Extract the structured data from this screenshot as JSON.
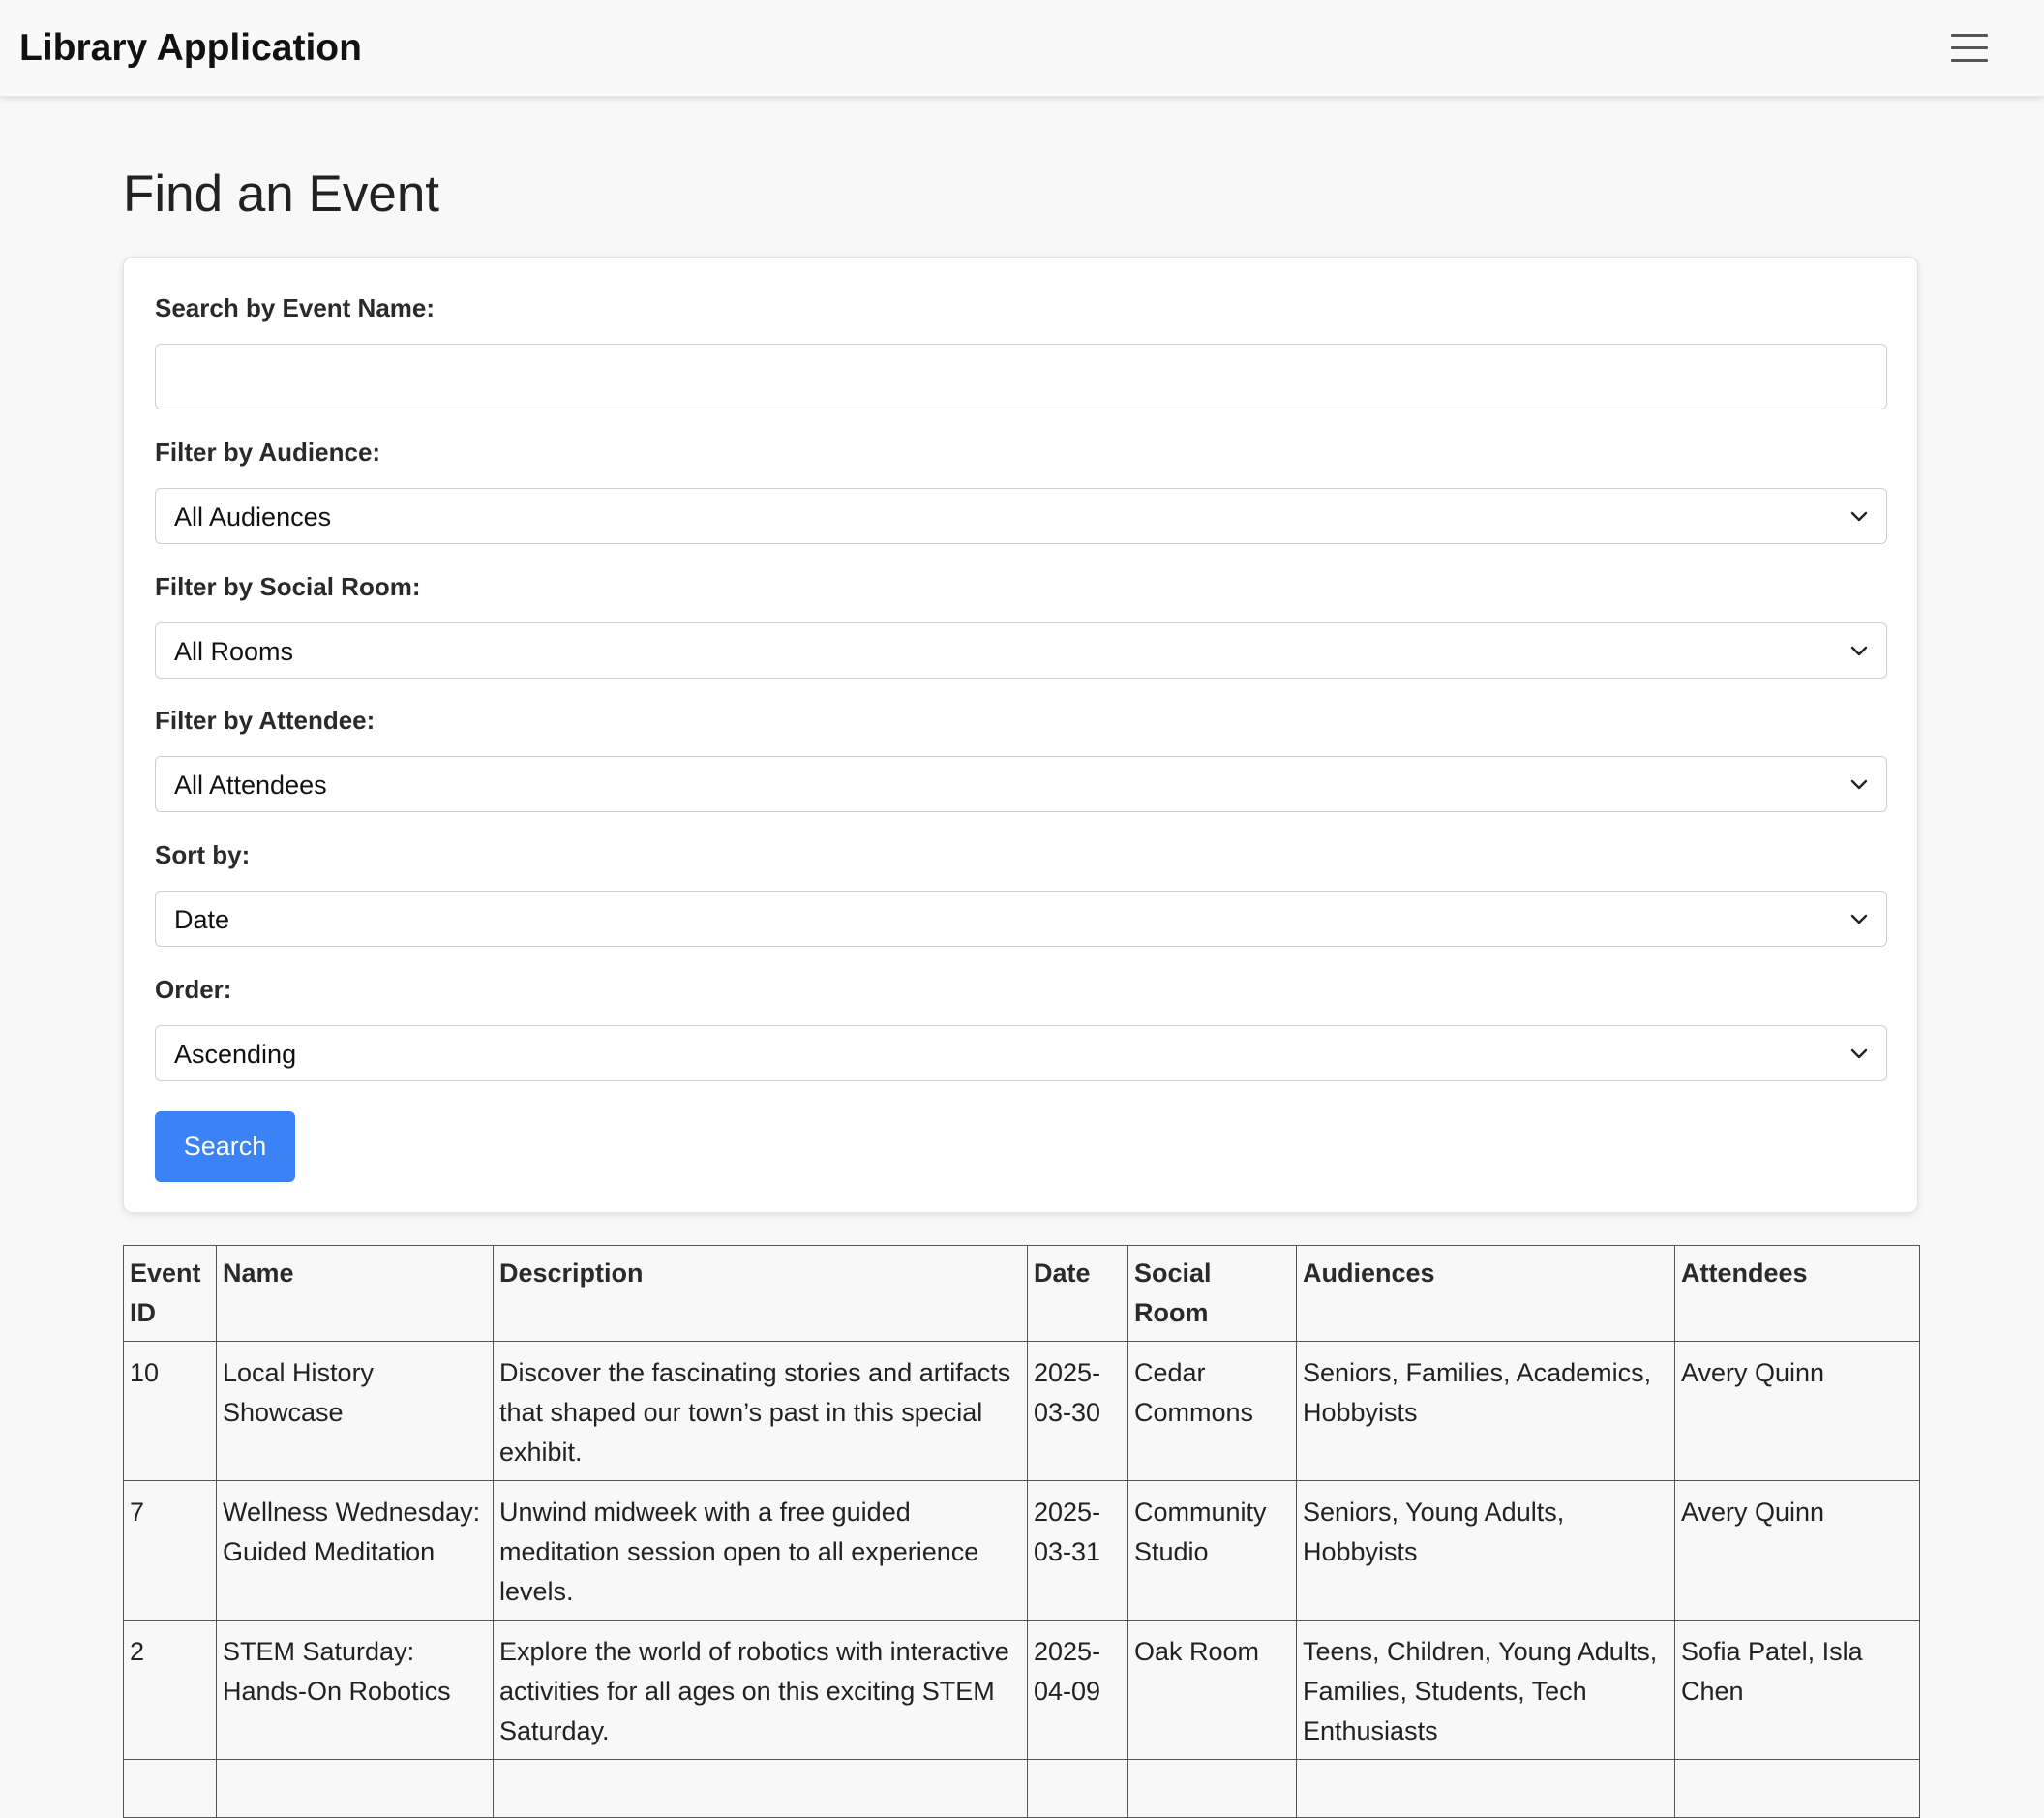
{
  "app": {
    "title": "Library Application",
    "menu_icon": "hamburger-menu-icon"
  },
  "page": {
    "title": "Find an Event"
  },
  "filters": {
    "search_label": "Search by Event Name:",
    "search_value": "",
    "search_placeholder": "",
    "audience_label": "Filter by Audience:",
    "audience_value": "All Audiences",
    "room_label": "Filter by Social Room:",
    "room_value": "All Rooms",
    "attendee_label": "Filter by Attendee:",
    "attendee_value": "All Attendees",
    "sort_label": "Sort by:",
    "sort_value": "Date",
    "order_label": "Order:",
    "order_value": "Ascending",
    "search_button": "Search"
  },
  "table": {
    "headers": [
      "Event ID",
      "Name",
      "Description",
      "Date",
      "Social Room",
      "Audiences",
      "Attendees"
    ],
    "rows": [
      {
        "id": "10",
        "name": "Local History Showcase",
        "description": "Discover the fascinating stories and artifacts that shaped our town’s past in this special exhibit.",
        "date": "2025-03-30",
        "room": "Cedar Commons",
        "audiences": "Seniors, Families, Academics, Hobbyists",
        "attendees": "Avery Quinn"
      },
      {
        "id": "7",
        "name": "Wellness Wednesday: Guided Meditation",
        "description": "Unwind midweek with a free guided meditation session open to all experience levels.",
        "date": "2025-03-31",
        "room": "Community Studio",
        "audiences": "Seniors, Young Adults, Hobbyists",
        "attendees": "Avery Quinn"
      },
      {
        "id": "2",
        "name": "STEM Saturday: Hands-On Robotics",
        "description": "Explore the world of robotics with interactive activities for all ages on this exciting STEM Saturday.",
        "date": "2025-04-09",
        "room": "Oak Room",
        "audiences": "Teens, Children, Young Adults, Families, Students, Tech Enthusiasts",
        "attendees": "Sofia Patel, Isla Chen"
      }
    ]
  },
  "colors": {
    "primary_button": "#3b82f6",
    "background": "#f8f8f8",
    "card": "#ffffff"
  }
}
